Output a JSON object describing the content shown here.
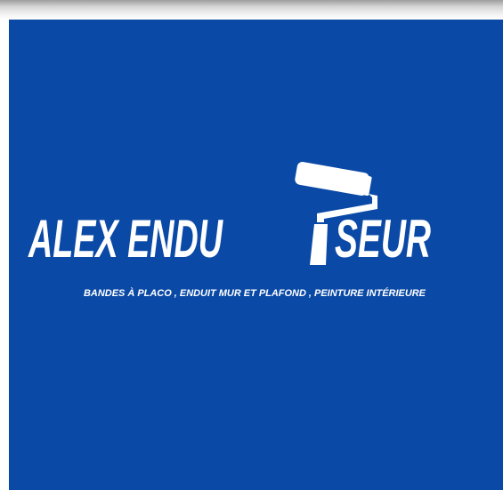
{
  "colors": {
    "background": "#0a49a6",
    "foreground": "#ffffff"
  },
  "logo": {
    "name_part1": "ALEX ENDU",
    "name_part2": "SEUR",
    "tagline": "BANDES À PLACO , ENDUIT MUR ET PLAFOND , PEINTURE INTÉRIEURE",
    "icon": "paint-roller-icon"
  }
}
